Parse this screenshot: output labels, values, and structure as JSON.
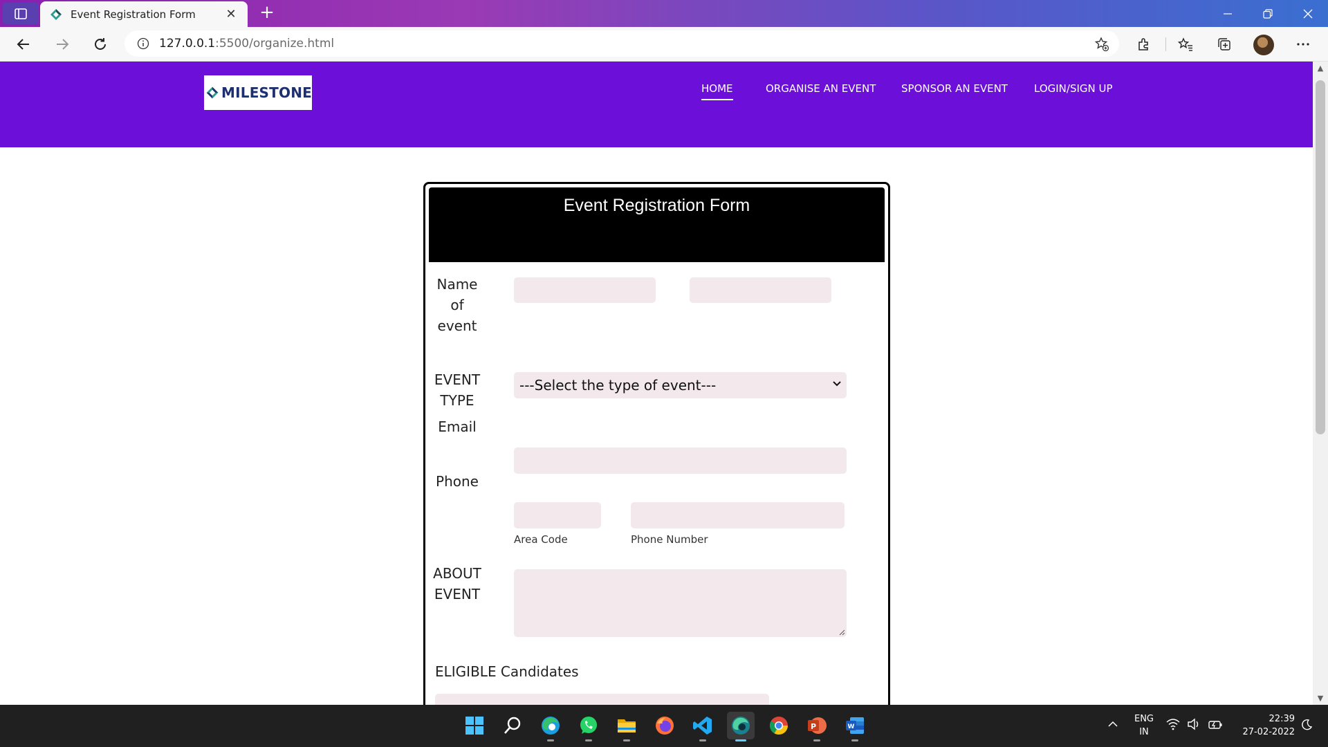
{
  "browser": {
    "tab_title": "Event Registration Form",
    "new_tab_label": "+",
    "url_host": "127.0.0.1",
    "url_path": ":5500/organize.html"
  },
  "site": {
    "logo_text": "MILESTONE",
    "nav": [
      {
        "label": "HOME",
        "active": true
      },
      {
        "label": "ORGANISE AN EVENT",
        "active": false
      },
      {
        "label": "SPONSOR AN EVENT",
        "active": false
      },
      {
        "label": "LOGIN/SIGN UP",
        "active": false
      }
    ],
    "header_color": "#6c0fd8"
  },
  "form": {
    "title": "Event Registration Form",
    "name_label": "Name of event",
    "name_label_lines": [
      "Name",
      "of",
      "event"
    ],
    "event_type_label_lines": [
      "EVENT",
      "TYPE"
    ],
    "event_type_selected": "---Select the type of event---",
    "email_label": "Email",
    "phone_label": "Phone",
    "area_code_label": "Area Code",
    "phone_number_label": "Phone Number",
    "about_label_lines": [
      "ABOUT",
      "EVENT"
    ],
    "eligible_label": "ELIGIBLE Candidates",
    "field_color": "#f3e9ec"
  },
  "taskbar": {
    "apps": [
      "start-icon",
      "search-icon",
      "edge-icon",
      "whatsapp-icon",
      "file-explorer-icon",
      "firefox-icon",
      "vscode-icon",
      "edge-dev-icon",
      "chrome-icon",
      "powerpoint-icon",
      "word-icon"
    ],
    "lang_line1": "ENG",
    "lang_line2": "IN",
    "time": "22:39",
    "date": "27-02-2022"
  }
}
